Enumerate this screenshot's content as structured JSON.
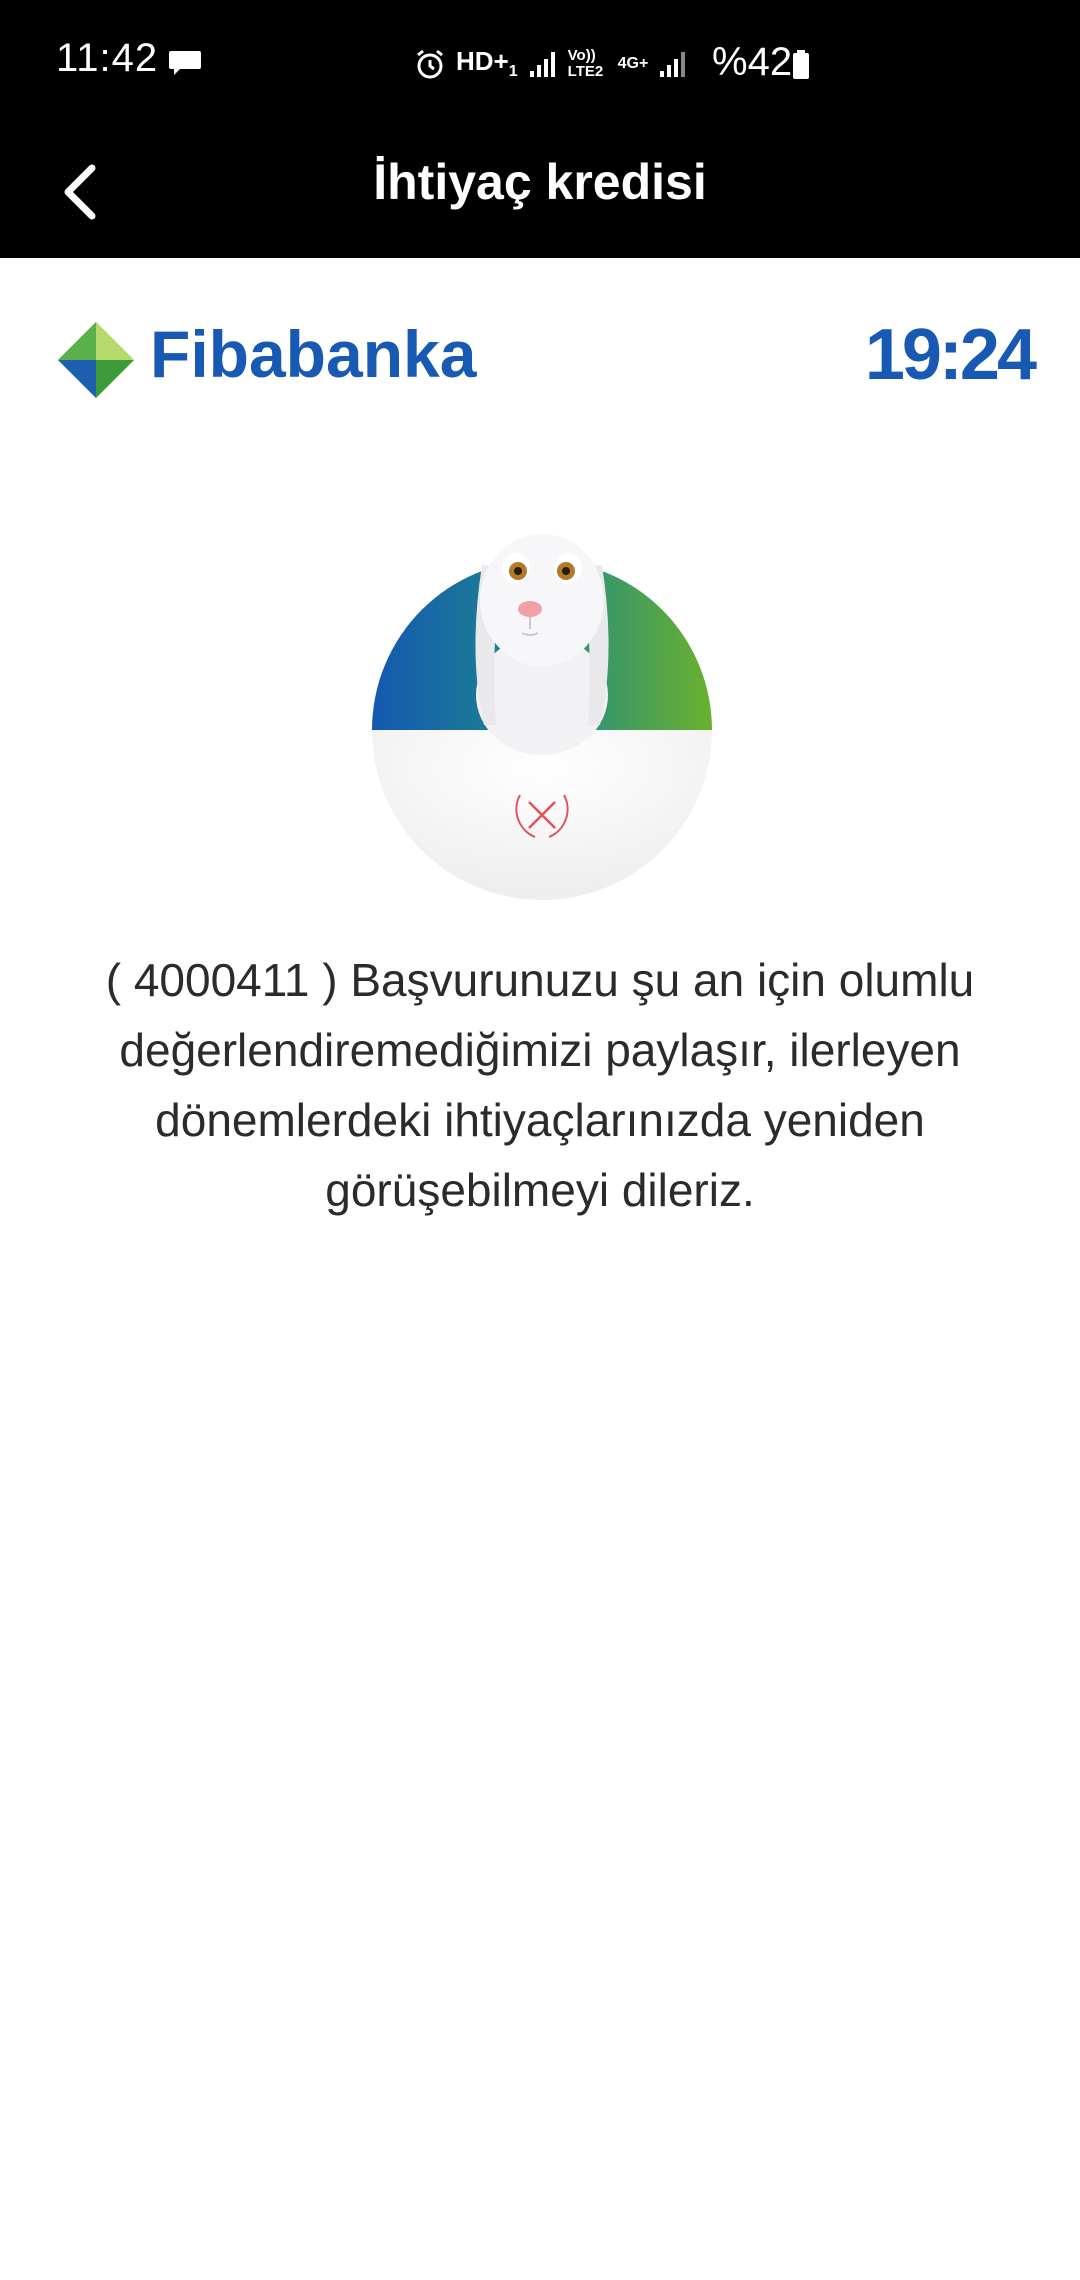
{
  "status_bar": {
    "time": "11:42",
    "network_label": "HD+",
    "network_sub": "1",
    "volte_label": "Vo)) LTE2",
    "data_label": "4G+",
    "battery": "%42"
  },
  "app_bar": {
    "title": "İhtiyaç kredisi"
  },
  "bank": {
    "name": "Fibabanka",
    "timer": "19:24"
  },
  "result": {
    "message": "( 4000411 ) Başvurunuzu şu an için olumlu değerlendiremediğimizi paylaşır, ilerleyen dönemlerdeki ihtiyaçlarınızda yeniden görüşebilmeyi dileriz."
  },
  "colors": {
    "brand_blue": "#1859b3",
    "error_red": "#e0525c",
    "logo_green": "#6cb52d"
  }
}
